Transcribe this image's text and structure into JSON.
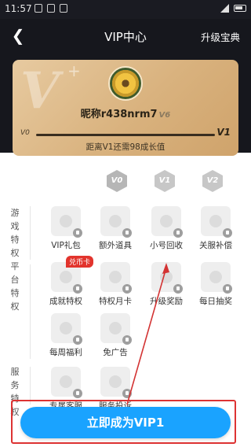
{
  "status_bar": {
    "time": "11:57"
  },
  "header": {
    "title": "VIP中心",
    "guide_link": "升级宝典"
  },
  "card": {
    "nickname": "昵称r438nrm7",
    "level_tag": "V6",
    "level_left": "V0",
    "level_right": "V1",
    "progress_caption": "距离V1还需98成长值",
    "progress_fraction": 0.0
  },
  "levels": [
    "V0",
    "V1",
    "V2"
  ],
  "sections": {
    "game": {
      "label": "游戏特权"
    },
    "platform": {
      "label": "平台特权"
    },
    "service": {
      "label": "服务特权"
    }
  },
  "perks": {
    "gift": "VIP礼包",
    "extra_items": "额外道具",
    "alt_recycle": "小号回收",
    "server_comp": "关服补偿",
    "achievement": "成就特权",
    "monthly_card": "特权月卡",
    "upgrade_reward": "升级奖励",
    "daily_draw": "每日抽奖",
    "weekly_welfare": "每周福利",
    "no_ads": "免广告",
    "exclusive_cs": "专属客服",
    "service_complaint": "服务投诉",
    "coin_tag": "兑币卡"
  },
  "cta": {
    "label": "立即成为VIP1"
  },
  "colors": {
    "accent": "#1aa3ff",
    "annotation": "#d33333",
    "gold": "#d9b27e"
  }
}
